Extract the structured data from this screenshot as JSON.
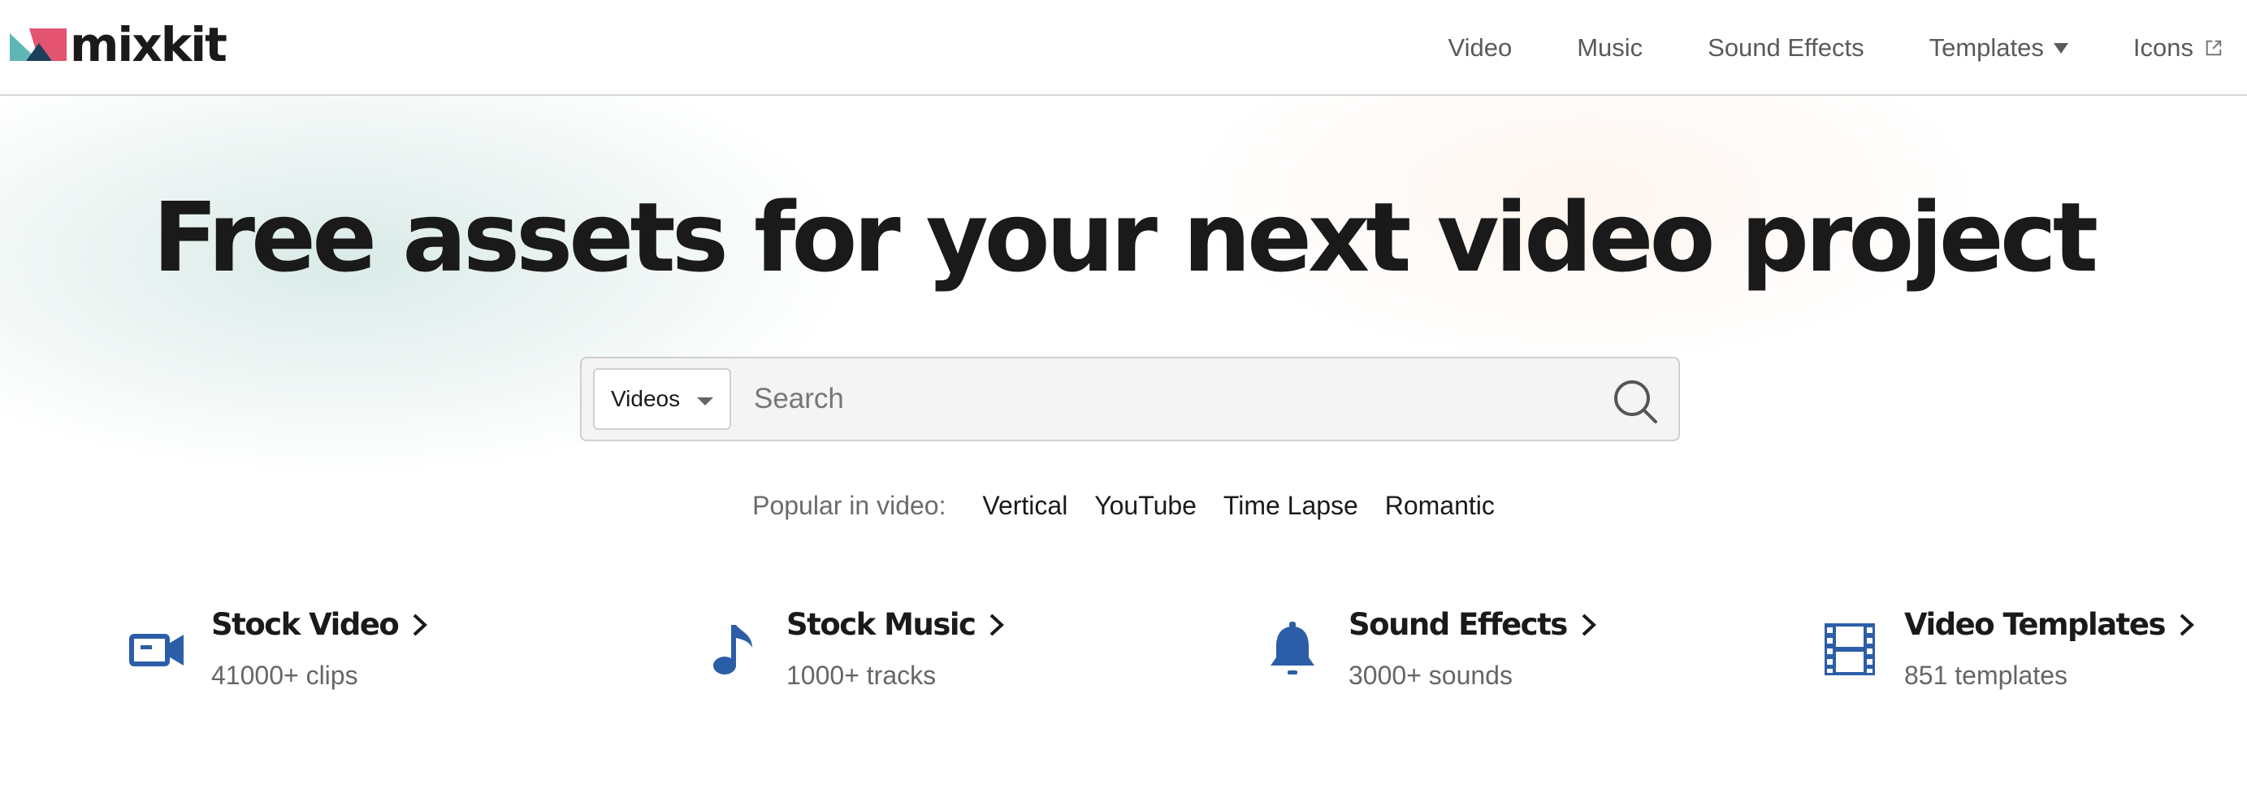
{
  "brand": {
    "name": "mixkit"
  },
  "nav": {
    "items": [
      {
        "label": "Video"
      },
      {
        "label": "Music"
      },
      {
        "label": "Sound Effects"
      },
      {
        "label": "Templates"
      },
      {
        "label": "Icons"
      }
    ]
  },
  "hero": {
    "title": "Free assets for your next video project"
  },
  "search": {
    "category": "Videos",
    "placeholder": "Search"
  },
  "popular": {
    "label": "Popular in video:",
    "tags": [
      "Vertical",
      "YouTube",
      "Time Lapse",
      "Romantic"
    ]
  },
  "categories": [
    {
      "title": "Stock Video",
      "count": "41000+ clips",
      "icon": "video-camera-icon"
    },
    {
      "title": "Stock Music",
      "count": "1000+ tracks",
      "icon": "music-note-icon"
    },
    {
      "title": "Sound Effects",
      "count": "3000+ sounds",
      "icon": "bell-icon"
    },
    {
      "title": "Video Templates",
      "count": "851 templates",
      "icon": "film-strip-icon"
    }
  ],
  "colors": {
    "accent_blue": "#2c5ea8",
    "text_dark": "#1a1a1a",
    "text_muted": "#666666",
    "logo_teal": "#5fb7b5",
    "logo_pink": "#e2546f",
    "logo_navy": "#1f3d5c"
  }
}
